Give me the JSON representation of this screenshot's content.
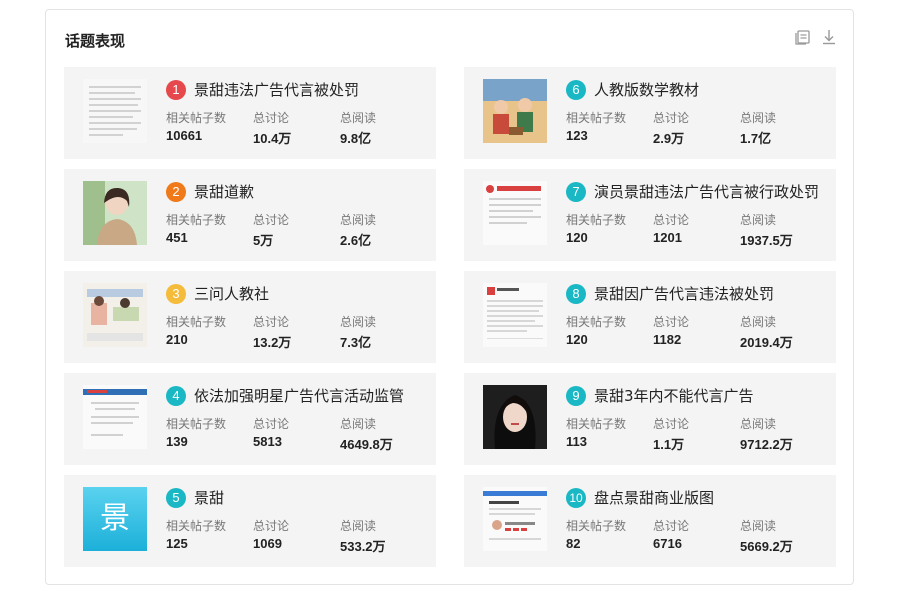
{
  "panel": {
    "title": "话题表现"
  },
  "toolbar": {
    "list_icon": "list-icon",
    "download_icon": "download-icon"
  },
  "labels": {
    "posts": "相关帖子数",
    "discussions": "总讨论",
    "reads": "总阅读"
  },
  "colors": {
    "rank1": "#e5484d",
    "rank2": "#f07a1a",
    "rank3": "#f5bb3a",
    "rank_other": "#1ab8c4",
    "card_bg": "#f4f4f4"
  },
  "topics": [
    {
      "rank": "1",
      "title": "景甜违法广告代言被处罚",
      "posts": "10661",
      "discussions": "10.4万",
      "reads": "9.8亿",
      "thumb": "document-thumbnail"
    },
    {
      "rank": "2",
      "title": "景甜道歉",
      "posts": "451",
      "discussions": "5万",
      "reads": "2.6亿",
      "thumb": "portrait-photo-thumbnail"
    },
    {
      "rank": "3",
      "title": "三问人教社",
      "posts": "210",
      "discussions": "13.2万",
      "reads": "7.3亿",
      "thumb": "textbook-illustration-thumbnail"
    },
    {
      "rank": "4",
      "title": "依法加强明星广告代言活动监管",
      "posts": "139",
      "discussions": "5813",
      "reads": "4649.8万",
      "thumb": "news-page-thumbnail"
    },
    {
      "rank": "5",
      "title": "景甜",
      "posts": "125",
      "discussions": "1069",
      "reads": "533.2万",
      "thumb": "topic-glyph-thumbnail",
      "glyph": "景"
    },
    {
      "rank": "6",
      "title": "人教版数学教材",
      "posts": "123",
      "discussions": "2.9万",
      "reads": "1.7亿",
      "thumb": "cartoon-illustration-thumbnail"
    },
    {
      "rank": "7",
      "title": "演员景甜违法广告代言被行政处罚",
      "posts": "120",
      "discussions": "1201",
      "reads": "1937.5万",
      "thumb": "news-page-thumbnail"
    },
    {
      "rank": "8",
      "title": "景甜因广告代言违法被处罚",
      "posts": "120",
      "discussions": "1182",
      "reads": "2019.4万",
      "thumb": "social-post-thumbnail"
    },
    {
      "rank": "9",
      "title": "景甜3年内不能代言广告",
      "posts": "113",
      "discussions": "1.1万",
      "reads": "9712.2万",
      "thumb": "portrait-photo-thumbnail"
    },
    {
      "rank": "10",
      "title": "盘点景甜商业版图",
      "posts": "82",
      "discussions": "6716",
      "reads": "5669.2万",
      "thumb": "webpage-screenshot-thumbnail"
    }
  ]
}
